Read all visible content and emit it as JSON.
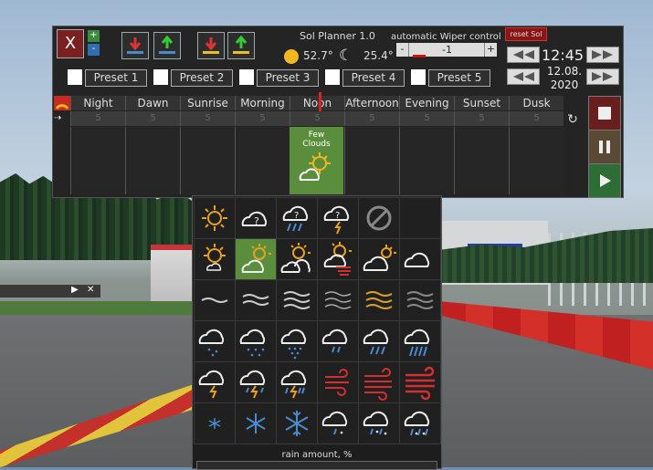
{
  "window": {
    "title": "Sol Planner 1.0",
    "close_label": "X",
    "plus": "+",
    "minus": "-"
  },
  "wiper": {
    "title": "automatic Wiper control",
    "value": "-1",
    "minus": "-",
    "plus": "+",
    "reset_label": "reset Sol"
  },
  "sun": {
    "temp": "52.7°"
  },
  "moon": {
    "icon": "☾",
    "temp": "25.4°"
  },
  "clock": {
    "time": "12:45",
    "date_line1": "12.08.",
    "date_line2": "2020"
  },
  "presets": [
    "Preset 1",
    "Preset 2",
    "Preset 3",
    "Preset 4",
    "Preset 5"
  ],
  "columns": [
    "Night",
    "Dawn",
    "Sunrise",
    "Morning",
    "Noon",
    "Afternoon",
    "Evening",
    "Sunset",
    "Dusk"
  ],
  "column_value": "5",
  "active_cell": {
    "line1": "Few",
    "line2": "Clouds"
  },
  "mini_bar": {
    "play": "▶",
    "close": "✕"
  },
  "picker": {
    "rain_label": "rain amount, %"
  },
  "colors": {
    "accent_green": "#5b8e3c",
    "close_red": "#7a2020",
    "sun_yellow": "#f0b721",
    "icon_orange": "#e8a020",
    "icon_blue": "#4a8ad0",
    "icon_red": "#d23030"
  }
}
